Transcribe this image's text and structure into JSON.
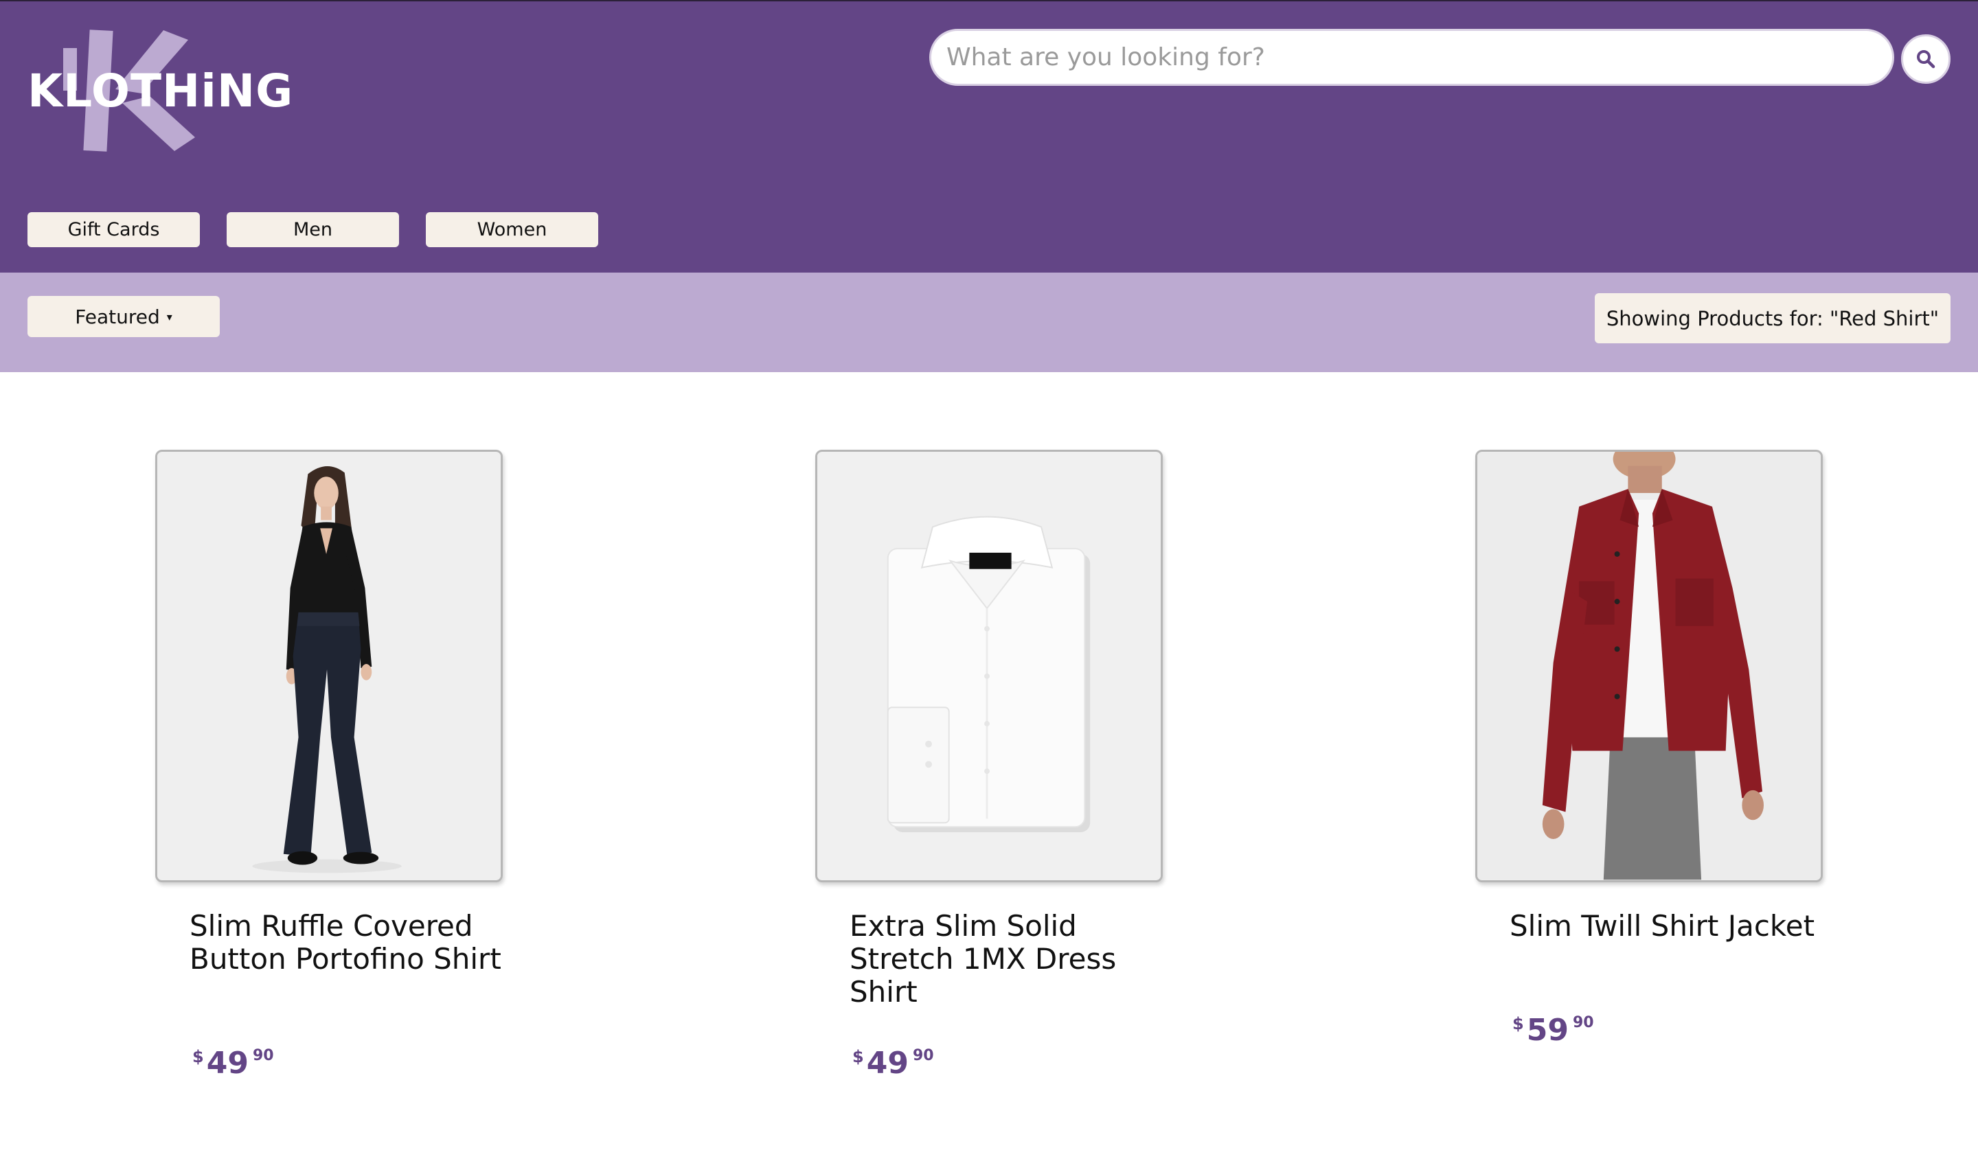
{
  "brand": {
    "logo_text": "KLOTHiNG"
  },
  "colors": {
    "header_bg": "#634586",
    "filterbar_bg": "#bcaad1",
    "button_bg": "#f6f0e8",
    "price": "#634586",
    "logo_k": "#bcaad1"
  },
  "search": {
    "placeholder": "What are you looking for?",
    "value": "",
    "button_icon": "magnifier-icon"
  },
  "nav": {
    "items": [
      {
        "label": "Gift Cards"
      },
      {
        "label": "Men"
      },
      {
        "label": "Women"
      }
    ]
  },
  "filter": {
    "sort_label": "Featured",
    "sort_caret": "▾",
    "results_note": "Showing Products for:  \"Red Shirt\""
  },
  "products": [
    {
      "title": "Slim Ruffle Covered Button Portofino Shirt",
      "currency": "$",
      "price_whole": "49",
      "price_cents": "90",
      "image": "model-black-blouse-jeans"
    },
    {
      "title": "Extra Slim Solid Stretch 1MX Dress Shirt",
      "currency": "$",
      "price_whole": "49",
      "price_cents": "90",
      "image": "folded-white-dress-shirt"
    },
    {
      "title": "Slim Twill Shirt Jacket",
      "currency": "$",
      "price_whole": "59",
      "price_cents": "90",
      "image": "model-red-shirt-jacket"
    }
  ]
}
